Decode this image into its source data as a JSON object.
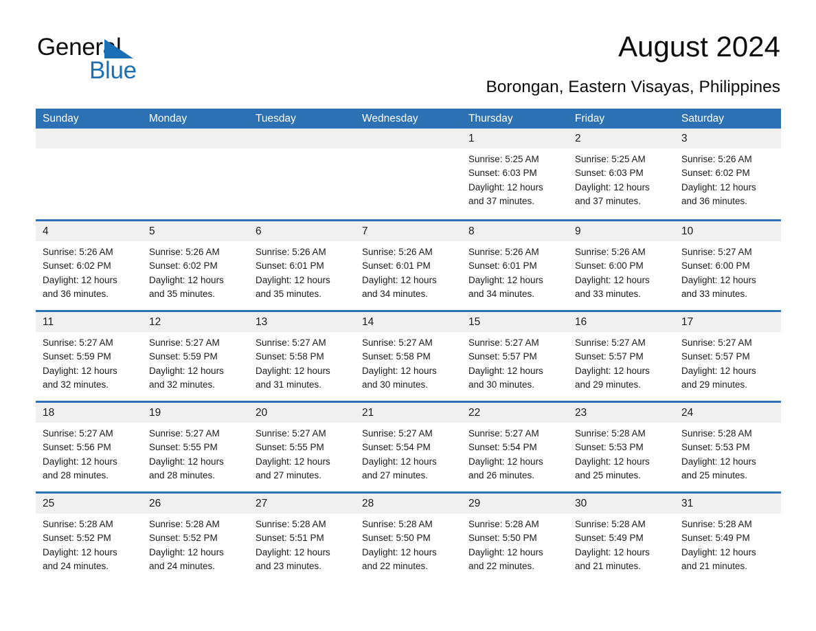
{
  "brand": {
    "name_part1": "General",
    "name_part2": "Blue",
    "triangle_color": "#1b6fb5",
    "text_color": "#0d0d0d"
  },
  "header": {
    "title": "August 2024",
    "subtitle": "Borongan, Eastern Visayas, Philippines"
  },
  "theme": {
    "header_blue": "#2c71b3",
    "day_band_gray": "#f0f0f0",
    "cell_white": "#ffffff",
    "text_black": "#1a1a1a"
  },
  "weekdays": [
    "Sunday",
    "Monday",
    "Tuesday",
    "Wednesday",
    "Thursday",
    "Friday",
    "Saturday"
  ],
  "weeks": [
    [
      {
        "day": "",
        "empty": true,
        "lines": []
      },
      {
        "day": "",
        "empty": true,
        "lines": []
      },
      {
        "day": "",
        "empty": true,
        "lines": []
      },
      {
        "day": "",
        "empty": true,
        "lines": []
      },
      {
        "day": "1",
        "empty": false,
        "lines": [
          "Sunrise: 5:25 AM",
          "Sunset: 6:03 PM",
          "Daylight: 12 hours",
          "and 37 minutes."
        ]
      },
      {
        "day": "2",
        "empty": false,
        "lines": [
          "Sunrise: 5:25 AM",
          "Sunset: 6:03 PM",
          "Daylight: 12 hours",
          "and 37 minutes."
        ]
      },
      {
        "day": "3",
        "empty": false,
        "lines": [
          "Sunrise: 5:26 AM",
          "Sunset: 6:02 PM",
          "Daylight: 12 hours",
          "and 36 minutes."
        ]
      }
    ],
    [
      {
        "day": "4",
        "empty": false,
        "lines": [
          "Sunrise: 5:26 AM",
          "Sunset: 6:02 PM",
          "Daylight: 12 hours",
          "and 36 minutes."
        ]
      },
      {
        "day": "5",
        "empty": false,
        "lines": [
          "Sunrise: 5:26 AM",
          "Sunset: 6:02 PM",
          "Daylight: 12 hours",
          "and 35 minutes."
        ]
      },
      {
        "day": "6",
        "empty": false,
        "lines": [
          "Sunrise: 5:26 AM",
          "Sunset: 6:01 PM",
          "Daylight: 12 hours",
          "and 35 minutes."
        ]
      },
      {
        "day": "7",
        "empty": false,
        "lines": [
          "Sunrise: 5:26 AM",
          "Sunset: 6:01 PM",
          "Daylight: 12 hours",
          "and 34 minutes."
        ]
      },
      {
        "day": "8",
        "empty": false,
        "lines": [
          "Sunrise: 5:26 AM",
          "Sunset: 6:01 PM",
          "Daylight: 12 hours",
          "and 34 minutes."
        ]
      },
      {
        "day": "9",
        "empty": false,
        "lines": [
          "Sunrise: 5:26 AM",
          "Sunset: 6:00 PM",
          "Daylight: 12 hours",
          "and 33 minutes."
        ]
      },
      {
        "day": "10",
        "empty": false,
        "lines": [
          "Sunrise: 5:27 AM",
          "Sunset: 6:00 PM",
          "Daylight: 12 hours",
          "and 33 minutes."
        ]
      }
    ],
    [
      {
        "day": "11",
        "empty": false,
        "lines": [
          "Sunrise: 5:27 AM",
          "Sunset: 5:59 PM",
          "Daylight: 12 hours",
          "and 32 minutes."
        ]
      },
      {
        "day": "12",
        "empty": false,
        "lines": [
          "Sunrise: 5:27 AM",
          "Sunset: 5:59 PM",
          "Daylight: 12 hours",
          "and 32 minutes."
        ]
      },
      {
        "day": "13",
        "empty": false,
        "lines": [
          "Sunrise: 5:27 AM",
          "Sunset: 5:58 PM",
          "Daylight: 12 hours",
          "and 31 minutes."
        ]
      },
      {
        "day": "14",
        "empty": false,
        "lines": [
          "Sunrise: 5:27 AM",
          "Sunset: 5:58 PM",
          "Daylight: 12 hours",
          "and 30 minutes."
        ]
      },
      {
        "day": "15",
        "empty": false,
        "lines": [
          "Sunrise: 5:27 AM",
          "Sunset: 5:57 PM",
          "Daylight: 12 hours",
          "and 30 minutes."
        ]
      },
      {
        "day": "16",
        "empty": false,
        "lines": [
          "Sunrise: 5:27 AM",
          "Sunset: 5:57 PM",
          "Daylight: 12 hours",
          "and 29 minutes."
        ]
      },
      {
        "day": "17",
        "empty": false,
        "lines": [
          "Sunrise: 5:27 AM",
          "Sunset: 5:57 PM",
          "Daylight: 12 hours",
          "and 29 minutes."
        ]
      }
    ],
    [
      {
        "day": "18",
        "empty": false,
        "lines": [
          "Sunrise: 5:27 AM",
          "Sunset: 5:56 PM",
          "Daylight: 12 hours",
          "and 28 minutes."
        ]
      },
      {
        "day": "19",
        "empty": false,
        "lines": [
          "Sunrise: 5:27 AM",
          "Sunset: 5:55 PM",
          "Daylight: 12 hours",
          "and 28 minutes."
        ]
      },
      {
        "day": "20",
        "empty": false,
        "lines": [
          "Sunrise: 5:27 AM",
          "Sunset: 5:55 PM",
          "Daylight: 12 hours",
          "and 27 minutes."
        ]
      },
      {
        "day": "21",
        "empty": false,
        "lines": [
          "Sunrise: 5:27 AM",
          "Sunset: 5:54 PM",
          "Daylight: 12 hours",
          "and 27 minutes."
        ]
      },
      {
        "day": "22",
        "empty": false,
        "lines": [
          "Sunrise: 5:27 AM",
          "Sunset: 5:54 PM",
          "Daylight: 12 hours",
          "and 26 minutes."
        ]
      },
      {
        "day": "23",
        "empty": false,
        "lines": [
          "Sunrise: 5:28 AM",
          "Sunset: 5:53 PM",
          "Daylight: 12 hours",
          "and 25 minutes."
        ]
      },
      {
        "day": "24",
        "empty": false,
        "lines": [
          "Sunrise: 5:28 AM",
          "Sunset: 5:53 PM",
          "Daylight: 12 hours",
          "and 25 minutes."
        ]
      }
    ],
    [
      {
        "day": "25",
        "empty": false,
        "lines": [
          "Sunrise: 5:28 AM",
          "Sunset: 5:52 PM",
          "Daylight: 12 hours",
          "and 24 minutes."
        ]
      },
      {
        "day": "26",
        "empty": false,
        "lines": [
          "Sunrise: 5:28 AM",
          "Sunset: 5:52 PM",
          "Daylight: 12 hours",
          "and 24 minutes."
        ]
      },
      {
        "day": "27",
        "empty": false,
        "lines": [
          "Sunrise: 5:28 AM",
          "Sunset: 5:51 PM",
          "Daylight: 12 hours",
          "and 23 minutes."
        ]
      },
      {
        "day": "28",
        "empty": false,
        "lines": [
          "Sunrise: 5:28 AM",
          "Sunset: 5:50 PM",
          "Daylight: 12 hours",
          "and 22 minutes."
        ]
      },
      {
        "day": "29",
        "empty": false,
        "lines": [
          "Sunrise: 5:28 AM",
          "Sunset: 5:50 PM",
          "Daylight: 12 hours",
          "and 22 minutes."
        ]
      },
      {
        "day": "30",
        "empty": false,
        "lines": [
          "Sunrise: 5:28 AM",
          "Sunset: 5:49 PM",
          "Daylight: 12 hours",
          "and 21 minutes."
        ]
      },
      {
        "day": "31",
        "empty": false,
        "lines": [
          "Sunrise: 5:28 AM",
          "Sunset: 5:49 PM",
          "Daylight: 12 hours",
          "and 21 minutes."
        ]
      }
    ]
  ]
}
